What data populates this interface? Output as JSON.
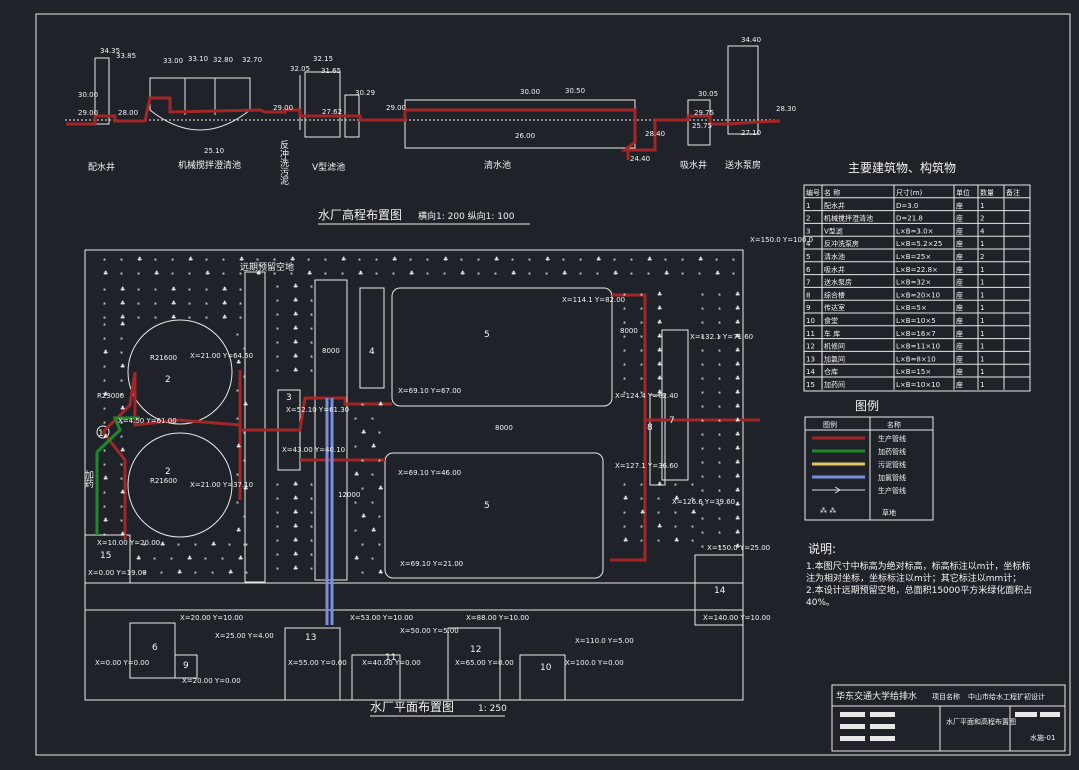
{
  "profile": {
    "title": "水厂高程布置图",
    "scale": "横向1: 200 纵向1: 100",
    "units": [
      {
        "name": "配水井",
        "elev": [
          "34.35",
          "33.85",
          "30.00",
          "29.00",
          "28.00"
        ]
      },
      {
        "name": "机械搅拌澄清池",
        "elev": [
          "33.00",
          "33.10",
          "32.80",
          "32.70",
          "25.10"
        ]
      },
      {
        "name": "反冲洗污泥",
        "elev": [
          "32.05",
          "32.15",
          "31.65",
          "29.00"
        ]
      },
      {
        "name": "V型滤池",
        "elev": [
          "27.62",
          "30.29",
          "29.00"
        ]
      },
      {
        "name": "清水池",
        "elev": [
          "30.00",
          "30.50",
          "26.00",
          "28.40",
          "24.40"
        ]
      },
      {
        "name": "吸水井",
        "elev": [
          "30.05",
          "29.75",
          "25.75"
        ]
      },
      {
        "name": "送水泵房",
        "elev": [
          "34.40",
          "28.30",
          "27.10"
        ]
      }
    ]
  },
  "plan": {
    "title": "水厂平面布置图",
    "scale": "1: 250",
    "reserved_land": "远期预留空地",
    "dose_label": "加药",
    "dims": [
      "8000",
      "8000",
      "8000",
      "12000",
      "R23000",
      "R21600",
      "R21600"
    ],
    "coords": [
      "X=150.0 Y=100.0",
      "X=114.1 Y=82.00",
      "X=21.00 Y=64.50",
      "X=4.50 Y=61.00",
      "X=52.10 Y=61.30",
      "X=69.10 Y=67.00",
      "X=124.4 Y=62.40",
      "X=132.1 Y=71.60",
      "X=43.00 Y=40.10",
      "X=21.00 Y=37.10",
      "X=69.10 Y=46.00",
      "X=127.1 Y=36.60",
      "X=126.6 Y=39.60",
      "X=10.00 Y=20.00",
      "X=69.10 Y=21.00",
      "X=150.0 Y=25.00",
      "X=0.00 Y=19.00",
      "X=20.00 Y=10.00",
      "X=53.00 Y=10.00",
      "X=88.00 Y=10.00",
      "X=50.00 Y=5.00",
      "X=110.0 Y=5.00",
      "X=140.00 Y=10.00",
      "X=25.00 Y=4.00",
      "X=0.00 Y=0.00",
      "X=20.00 Y=0.00",
      "X=55.00 Y=0.00",
      "X=40.00 Y=0.00",
      "X=65.00 Y=0.00",
      "X=100.0 Y=0.00"
    ],
    "ids": [
      "1",
      "2",
      "2",
      "3",
      "4",
      "5",
      "5",
      "6",
      "7",
      "8",
      "9",
      "10",
      "11",
      "12",
      "13",
      "14",
      "15"
    ]
  },
  "table": {
    "title": "主要建筑物、构筑物",
    "headers": [
      "编号",
      "名 称",
      "尺寸(m)",
      "单位",
      "数量",
      "备注"
    ],
    "rows": [
      [
        "1",
        "配水井",
        "D=3.0",
        "座",
        "1",
        ""
      ],
      [
        "2",
        "机械搅拌澄清池",
        "D=21.8",
        "座",
        "2",
        ""
      ],
      [
        "3",
        "V型滤",
        "L×B=3.0×",
        "座",
        "4",
        ""
      ],
      [
        "4",
        "反冲洗泵房",
        "L×B=5.2×25",
        "座",
        "1",
        ""
      ],
      [
        "5",
        "清水池",
        "L×B=25×",
        "座",
        "2",
        ""
      ],
      [
        "6",
        "吸水井",
        "L×B=22.8×",
        "座",
        "1",
        ""
      ],
      [
        "7",
        "送水泵房",
        "L×B=32×",
        "座",
        "1",
        ""
      ],
      [
        "8",
        "综合楼",
        "L×B=20×10",
        "座",
        "1",
        ""
      ],
      [
        "9",
        "传达室",
        "L×B=5×",
        "座",
        "1",
        ""
      ],
      [
        "10",
        "食堂",
        "L×B=10×5",
        "座",
        "1",
        ""
      ],
      [
        "11",
        "车 库",
        "L×B=16×7",
        "座",
        "1",
        ""
      ],
      [
        "12",
        "机修间",
        "L×B=11×10",
        "座",
        "1",
        ""
      ],
      [
        "13",
        "加氯间",
        "L×B=8×10",
        "座",
        "1",
        ""
      ],
      [
        "14",
        "仓库",
        "L×B=15×",
        "座",
        "1",
        ""
      ],
      [
        "15",
        "加药间",
        "L×B=10×10",
        "座",
        "1",
        ""
      ]
    ]
  },
  "legend": {
    "title": "图例",
    "headers": [
      "图例",
      "名称"
    ],
    "items": [
      {
        "name": "生产管线",
        "color": "#a32626"
      },
      {
        "name": "加药管线",
        "color": "#1f8a2a"
      },
      {
        "name": "污泥管线",
        "color": "#e1c46b"
      },
      {
        "name": "加氯管线",
        "color": "#7b8fe0"
      },
      {
        "name": "生产管线",
        "color": "#d9d9d9"
      },
      {
        "name": "草地",
        "color": "#d9d9d9"
      }
    ]
  },
  "notes": {
    "title": "说明:",
    "lines": [
      "1.本图尺寸中标高为绝对标高，标高标注以m计，坐标标",
      "注为相对坐标，坐标标注以m计；其它标注以mm计；",
      "2.本设计远期预留空地，总面积15000平方米绿化面积占",
      "40%。"
    ]
  },
  "titleblock": {
    "school": "华东交通大学给排水",
    "project_label": "项目名称",
    "project": "中山市给水工程扩初设计",
    "drawing": "水厂平面和高程布置图",
    "drawing_no": "水施-01"
  }
}
